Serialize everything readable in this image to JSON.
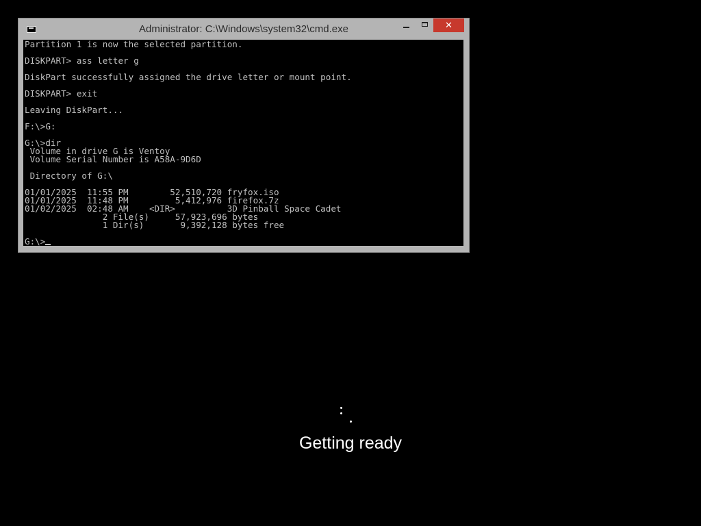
{
  "window": {
    "title": "Administrator: C:\\Windows\\system32\\cmd.exe",
    "icon": "cmd-icon",
    "controls": {
      "minimize_icon": "minimize-icon",
      "maximize_icon": "maximize-icon",
      "close_icon": "close-icon",
      "close_glyph": "✕",
      "close_color": "#c7392d"
    }
  },
  "console": {
    "background": "#000000",
    "foreground": "#c0c0c0",
    "lines": [
      "Partition 1 is now the selected partition.",
      "",
      "DISKPART> ass letter g",
      "",
      "DiskPart successfully assigned the drive letter or mount point.",
      "",
      "DISKPART> exit",
      "",
      "Leaving DiskPart...",
      "",
      "F:\\>G:",
      "",
      "G:\\>dir",
      " Volume in drive G is Ventoy",
      " Volume Serial Number is A58A-9D6D",
      "",
      " Directory of G:\\",
      "",
      "01/01/2025  11:55 PM        52,510,720 fryfox.iso",
      "01/01/2025  11:48 PM         5,412,976 firefox.7z",
      "01/02/2025  02:48 AM    <DIR>          3D Pinball Space Cadet",
      "               2 File(s)     57,923,696 bytes",
      "               1 Dir(s)       9,392,128 bytes free",
      "",
      "G:\\>"
    ]
  },
  "boot": {
    "status_text": "Getting ready",
    "spinner_icon": "loading-spinner-icon"
  }
}
